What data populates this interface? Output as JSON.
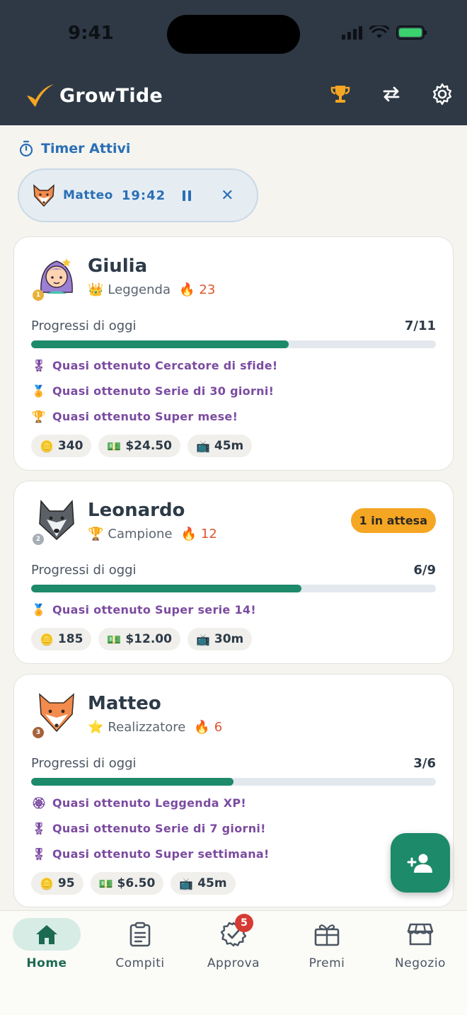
{
  "status": {
    "time": "9:41"
  },
  "app": {
    "name": "GrowTide"
  },
  "timers": {
    "header": "Timer Attivi",
    "active": {
      "name": "Matteo",
      "time": "19:42"
    }
  },
  "progress_label": "Progressi di oggi",
  "kids": [
    {
      "name": "Giulia",
      "level": "Leggenda",
      "streak": "23",
      "medal": "1",
      "progress": "7/11",
      "progress_fraction": 0.636,
      "achievements": [
        "Quasi ottenuto Cercatore di sfide!",
        "Quasi ottenuto Serie di 30 giorni!",
        "Quasi ottenuto Super mese!"
      ],
      "coins": "340",
      "money": "$24.50",
      "screen_time": "45m"
    },
    {
      "name": "Leonardo",
      "level": "Campione",
      "streak": "12",
      "medal": "2",
      "pending": "1 in attesa",
      "progress": "6/9",
      "progress_fraction": 0.667,
      "achievements": [
        "Quasi ottenuto Super serie 14!"
      ],
      "coins": "185",
      "money": "$12.00",
      "screen_time": "30m"
    },
    {
      "name": "Matteo",
      "level": "Realizzatore",
      "streak": "6",
      "medal": "3",
      "progress": "3/6",
      "progress_fraction": 0.5,
      "achievements": [
        "Quasi ottenuto Leggenda XP!",
        "Quasi ottenuto Serie di 7 giorni!",
        "Quasi ottenuto Super settimana!"
      ],
      "coins": "95",
      "money": "$6.50",
      "screen_time": "45m"
    }
  ],
  "tabs": [
    {
      "label": "Home",
      "active": true
    },
    {
      "label": "Compiti"
    },
    {
      "label": "Approva",
      "badge": "5"
    },
    {
      "label": "Premi"
    },
    {
      "label": "Negozio"
    }
  ],
  "colors": {
    "header": "#2e3945",
    "accent": "#1d8a6a",
    "timer": "#2a6fb5",
    "achievement": "#7b4ba0",
    "pending": "#f5a623"
  }
}
